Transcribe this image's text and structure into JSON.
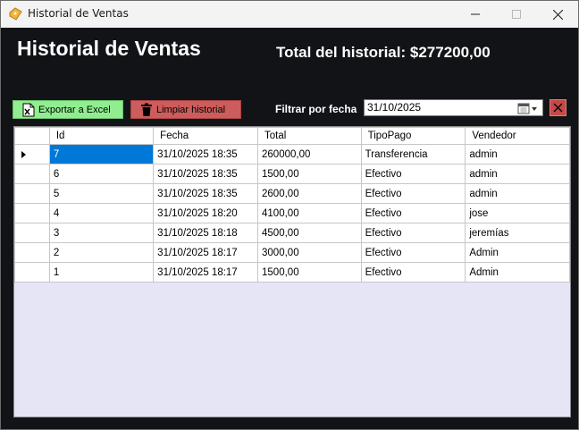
{
  "window": {
    "title": "Historial de Ventas",
    "app_icon": "ticket-icon",
    "controls": [
      "minimize-icon",
      "maximize-icon",
      "close-icon"
    ]
  },
  "header": {
    "title": "Historial de Ventas",
    "total_label": "Total del historial:",
    "total_value": "$277200,00"
  },
  "toolbar": {
    "export_label": "Exportar a Excel",
    "export_icon": "excel-icon",
    "export_color": "#90ee90",
    "clear_label": "Limpiar historial",
    "clear_icon": "trash-icon",
    "clear_color": "#cd5c5c"
  },
  "filter": {
    "label": "Filtrar por fecha",
    "date_value": "31/10/2025",
    "calendar_icon": "calendar-icon",
    "clear_icon": "close-icon",
    "clear_color": "#c74848"
  },
  "table": {
    "columns": [
      "Id",
      "Fecha",
      "Total",
      "TipoPago",
      "Vendedor"
    ],
    "rows": [
      [
        "7",
        "31/10/2025 18:35",
        "260000,00",
        "Transferencia",
        "admin"
      ],
      [
        "6",
        "31/10/2025 18:35",
        "1500,00",
        "Efectivo",
        "admin"
      ],
      [
        "5",
        "31/10/2025 18:35",
        "2600,00",
        "Efectivo",
        "admin"
      ],
      [
        "4",
        "31/10/2025 18:20",
        "4100,00",
        "Efectivo",
        "jose"
      ],
      [
        "3",
        "31/10/2025 18:18",
        "4500,00",
        "Efectivo",
        "jeremías"
      ],
      [
        "2",
        "31/10/2025 18:17",
        "3000,00",
        "Efectivo",
        "Admin"
      ],
      [
        "1",
        "31/10/2025 18:17",
        "1500,00",
        "Efectivo",
        "Admin"
      ]
    ],
    "selected_row": 0,
    "selection_color": "#0078d7",
    "background_color": "#e5e5f6"
  }
}
